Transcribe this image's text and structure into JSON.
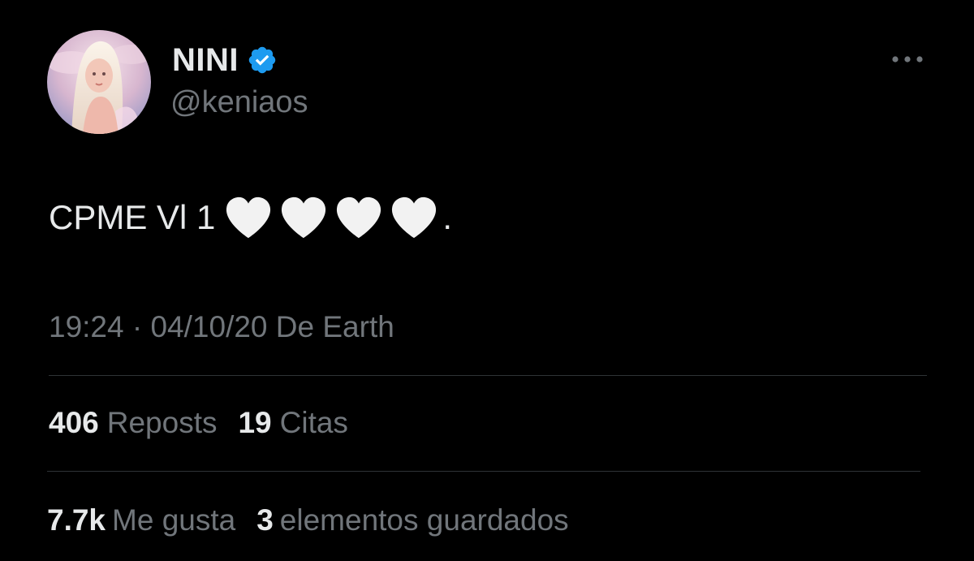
{
  "user": {
    "display_name": "NINI",
    "handle": "@keniaos"
  },
  "tweet": {
    "text": "CPME Vl 1",
    "hearts": 4,
    "trailing": ".",
    "time": "19:24",
    "date": "04/10/20",
    "source": "De Earth"
  },
  "stats": {
    "reposts_count": "406",
    "reposts_label": "Reposts",
    "quotes_count": "19",
    "quotes_label": "Citas",
    "likes_count": "7.7k",
    "likes_label": "Me gusta",
    "bookmarks_count": "3",
    "bookmarks_label": "elementos guardados"
  },
  "colors": {
    "background": "#000000",
    "primary_text": "#e7e9ea",
    "secondary_text": "#71767b",
    "divider": "#2f3336",
    "verified": "#1d9bf0"
  },
  "icons": {
    "verified": "verified-badge-icon",
    "more": "more-options-icon",
    "heart": "white-heart-emoji"
  }
}
